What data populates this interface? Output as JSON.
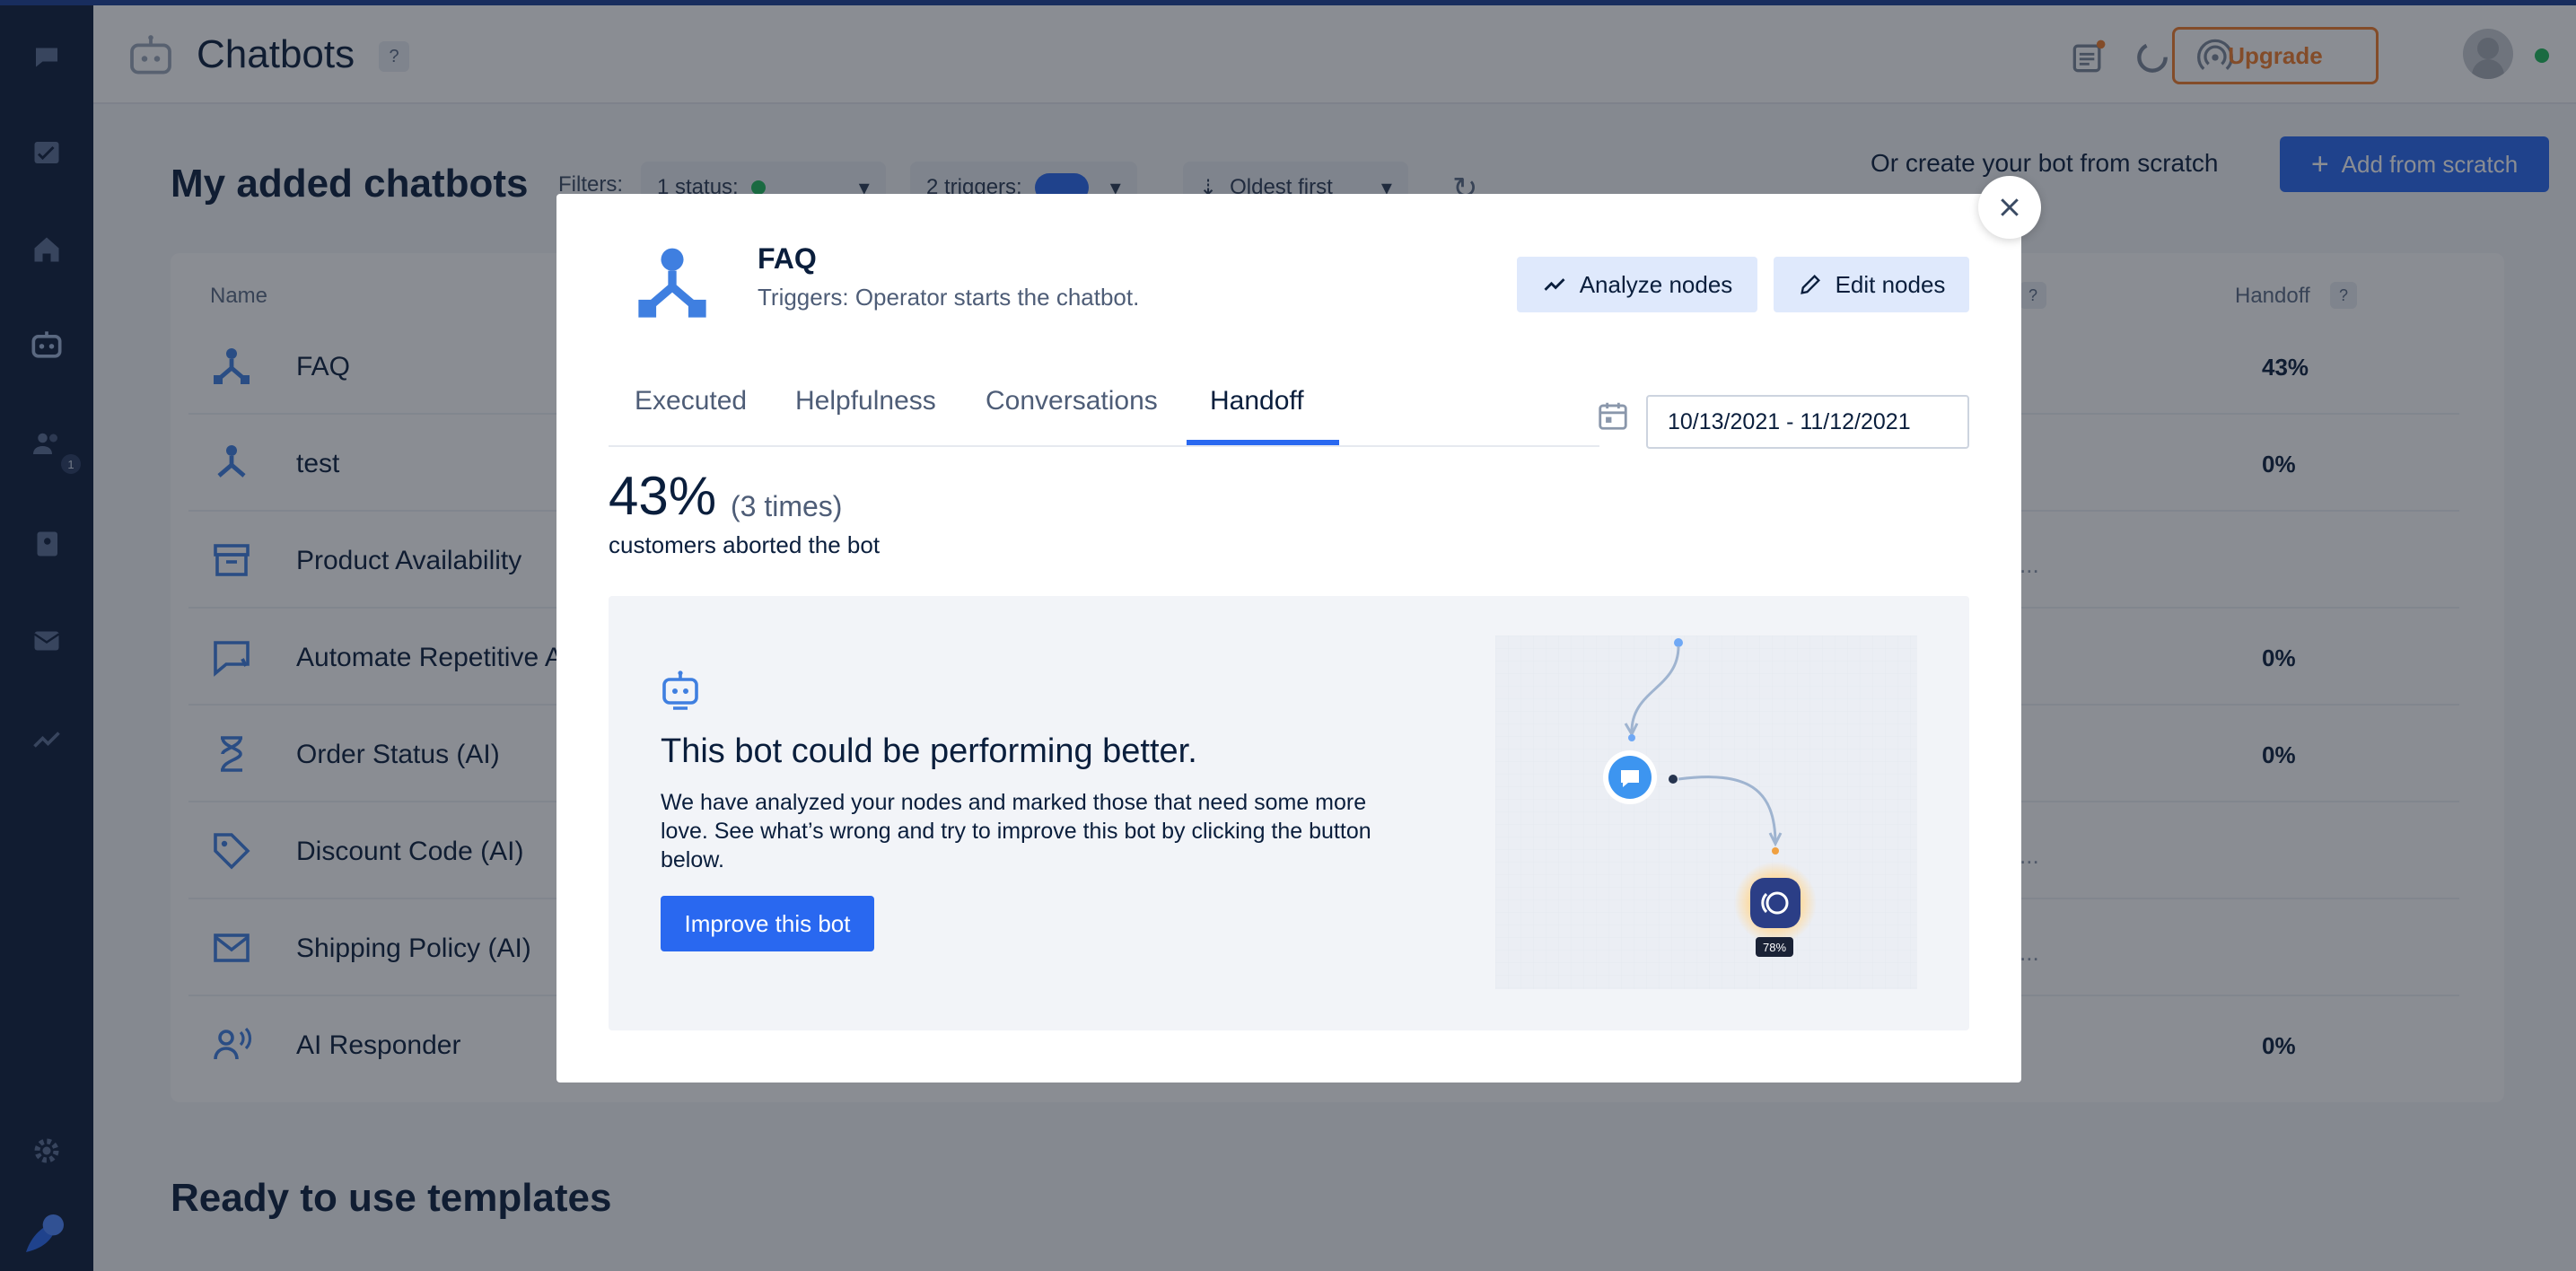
{
  "header": {
    "title": "Chatbots",
    "help": "?",
    "upgrade_label": "Upgrade"
  },
  "main": {
    "title": "My added chatbots",
    "filters_label": "Filters:",
    "filter_status": "1 status:",
    "filter_triggers": "2 triggers:",
    "filter_sort": "Oldest first",
    "scratch_text": "Or create your bot from scratch",
    "add_scratch_label": "Add from scratch",
    "columns": {
      "name": "Name",
      "handoff": "Handoff"
    },
    "rows": [
      {
        "name": "FAQ",
        "icon": "split-bot-icon",
        "handoff": "43%",
        "ellipsis": ""
      },
      {
        "name": "test",
        "icon": "split-bot-icon",
        "handoff": "0%",
        "ellipsis": ""
      },
      {
        "name": "Product Availability",
        "icon": "archive-icon",
        "handoff": "",
        "ellipsis": "..."
      },
      {
        "name": "Automate Repetitive A",
        "icon": "chat-alert-icon",
        "handoff": "0%",
        "ellipsis": ""
      },
      {
        "name": "Order Status (AI)",
        "icon": "hourglass-icon",
        "handoff": "0%",
        "ellipsis": ""
      },
      {
        "name": "Discount Code (AI)",
        "icon": "tag-icon",
        "handoff": "",
        "ellipsis": "..."
      },
      {
        "name": "Shipping Policy (AI)",
        "icon": "envelope-icon",
        "handoff": "",
        "ellipsis": "..."
      },
      {
        "name": "AI Responder",
        "icon": "person-speaking-icon",
        "handoff": "0%",
        "ellipsis": ""
      }
    ],
    "templates_title": "Ready to use templates"
  },
  "sidebar": {
    "badge": "1",
    "items": [
      "chat-icon",
      "inbox-icon",
      "home-icon",
      "bot-icon",
      "users-icon",
      "contacts-icon",
      "mail-icon",
      "analytics-icon",
      "settings-icon",
      "brand-logo-icon"
    ]
  },
  "modal": {
    "title": "FAQ",
    "subtitle": "Triggers: Operator starts the chatbot.",
    "analyze_label": "Analyze nodes",
    "edit_label": "Edit nodes",
    "tabs": [
      {
        "label": "Executed"
      },
      {
        "label": "Helpfulness"
      },
      {
        "label": "Conversations"
      },
      {
        "label": "Handoff"
      }
    ],
    "active_tab": "Handoff",
    "date_range": "10/13/2021 - 11/12/2021",
    "stat_percent": "43%",
    "stat_times": "(3 times)",
    "stat_caption": "customers aborted the bot",
    "promo": {
      "title": "This bot could be performing better.",
      "text": "We have analyzed your nodes and marked those that need some more love. See what’s wrong and try to improve this bot by clicking the button below.",
      "button": "Improve this bot",
      "node_badge": "78%"
    }
  },
  "colors": {
    "accent": "#2968f0",
    "upgrade": "#f07c2a",
    "sidebar": "#0d1c3b",
    "text": "#0a1e3c",
    "online": "#1fb85b"
  }
}
